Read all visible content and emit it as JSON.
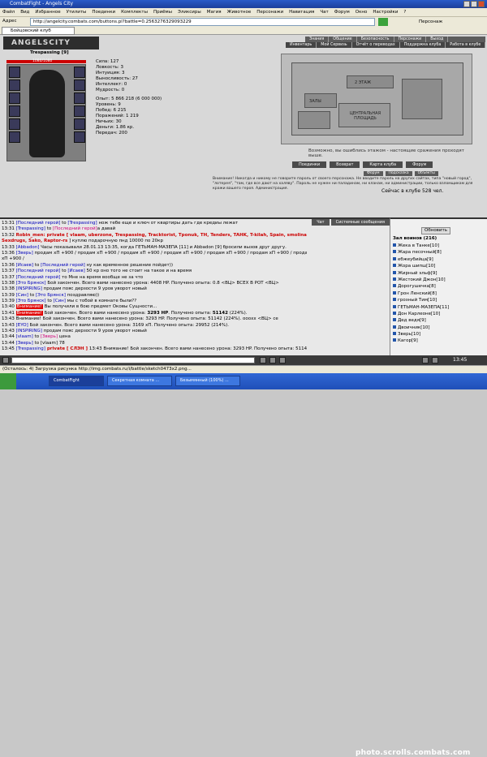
{
  "window": {
    "title": "CombatFight - Angels City"
  },
  "menu": [
    "Файл",
    "Вид",
    "Избранное",
    "Утилиты",
    "Поединки",
    "Комплекты",
    "Приёмы",
    "Эликсиры",
    "Магия",
    "Животное",
    "Персонажи",
    "Навигация",
    "Чат",
    "Форум",
    "Окно",
    "Настройки",
    "?"
  ],
  "address": {
    "label": "Адрес",
    "url": "http://angelcity.combats.com/buttons.pl?battle=0.2563276329093229",
    "go": "Персонаж"
  },
  "tab": {
    "label": "Бойцовский клуб"
  },
  "logo": {
    "text": "ANGELSCITY"
  },
  "topnav1": [
    "Знания",
    "Общение",
    "Безопасность",
    "Персонажи",
    "Выход"
  ],
  "topnav2": [
    "Инвентарь",
    "Мой Сервизь",
    "Отчёт о переводах",
    "Поддержка клуба",
    "Работа в клубе"
  ],
  "character": {
    "name": "Trespassing",
    "level": "[9]",
    "hp_label": "1080/1080",
    "hp_fraction": 1.0,
    "stats": [
      "Сила: 127",
      "Ловкость: 3",
      "Интуиция: 3",
      "Выносливость: 27",
      "Интеллект: 0",
      "Мудрость: 0"
    ],
    "stats2": [
      "Опыт: 5 866 218 (6 000 000)",
      "Уровень: 9",
      "Побед: 6 215",
      "Поражений: 1 219",
      "Ничьих: 30",
      "Деньги: 1.86 кр.",
      "Передач: 200"
    ]
  },
  "map": {
    "labels": [
      "2 ЭТАЖ",
      "ЗАЛЫ",
      "ЦЕНТРАЛЬНАЯ ПЛОЩАДЬ"
    ],
    "caption": "Возможно, вы ошиблись этажом - настоящие сражения проходят выше."
  },
  "actions": [
    "Поединки",
    "Возврат",
    "Карта клуба",
    "Форум"
  ],
  "small_actions": [
    "Форум",
    "Подсказка",
    "Объекты"
  ],
  "warning": "Внимание! Никогда и никому не говорите пароль от своего персонажа. Не вводите пароль на других сайтах, типа \"новый город\", \"лотерея\", \"там, где все дают на халяву\". Пароль не нужен ни паладинам, ни кланам, ни администрации, только взломщикам для кражи вашего героя. Администрация.",
  "club_online": "Сейчас в клубе 528 чел.",
  "chat_tabs": [
    "Чат",
    "Системные сообщения"
  ],
  "chat": [
    {
      "t": "13:31",
      "parts": [
        [
          "nick",
          "[Последний герой]"
        ],
        [
          "txt",
          " to "
        ],
        [
          "nick",
          "[Trespassing]"
        ],
        [
          "txt",
          " нож тебе еще и ключ от квартиры дать где кредиы лежат"
        ]
      ]
    },
    {
      "t": "13:31",
      "parts": [
        [
          "nick",
          "[Trespassing]"
        ],
        [
          "txt",
          " to "
        ],
        [
          "pink",
          "[Последний герой]"
        ],
        [
          "txt",
          "а давай"
        ]
      ]
    },
    {
      "t": "13:32",
      "parts": [
        [
          "red",
          "Robin_men: private [ vlaam, uberzone, Trespassing, Tracktorist, Tponuk, TH, Tenders, TAHK, T-kilah, Spain, smolina, silver knife,"
        ]
      ]
    },
    {
      "t": "",
      "parts": [
        [
          "red",
          "Sexdrugs, Sako, Raptor-rs"
        ],
        [
          "txt",
          " ] куплю подарочную пнд 10000 по 20кр"
        ]
      ]
    },
    {
      "t": "13:33",
      "parts": [
        [
          "nick",
          "[Abbadon]"
        ],
        [
          "txt",
          " Часы показывали 28.01.13 13:35, когда ГЕТЬМАН-МАЗЕПА [11] и Abbadon [9] бросили вызов друг другу."
        ]
      ]
    },
    {
      "t": "13:36",
      "parts": [
        [
          "nick",
          "[Зверь]"
        ],
        [
          "txt",
          " продам хП +900 / продам хП +900 / продам хП +900 / продам хП +900 / продам хП +900 / продам хП +900 / продам хП +900 / продам"
        ]
      ]
    },
    {
      "t": "",
      "parts": [
        [
          "txt",
          "хП +900 /"
        ]
      ]
    },
    {
      "t": "13:36",
      "parts": [
        [
          "nick",
          "[Исаев]"
        ],
        [
          "txt",
          " to "
        ],
        [
          "nick",
          "[Последний герой]"
        ],
        [
          "txt",
          " ну как временное решение пойдет))"
        ]
      ]
    },
    {
      "t": "13:37",
      "parts": [
        [
          "nick",
          "[Последний герой]"
        ],
        [
          "txt",
          " to "
        ],
        [
          "nick",
          "[Исаев]"
        ],
        [
          "txt",
          " 50 кр оно того не стоит на такое и на время"
        ]
      ]
    },
    {
      "t": "13:37",
      "parts": [
        [
          "nick",
          "[Последний герой]"
        ],
        [
          "txt",
          " то Мне на время вообще не за что"
        ]
      ]
    },
    {
      "t": "13:38",
      "parts": [
        [
          "nick",
          "[Это Брянск]"
        ],
        [
          "txt",
          " Бой закончен. Всего вами нанесено урона: 4408 HP. Получено опыта: 0.8 <ВЦ> ВСЕХ В РОТ <ВЦ>"
        ]
      ]
    },
    {
      "t": "13:38",
      "parts": [
        [
          "nick",
          "[INSPIRING]"
        ],
        [
          "txt",
          " продам пояс дерзости 9 уров уворот новый"
        ]
      ]
    },
    {
      "t": "13:39",
      "parts": [
        [
          "nick",
          "[Син]"
        ],
        [
          "txt",
          " to "
        ],
        [
          "nick",
          "[Это Брянск]"
        ],
        [
          "txt",
          " поздравляю))"
        ]
      ]
    },
    {
      "t": "13:39",
      "parts": [
        [
          "nick",
          "[Это Брянск]"
        ],
        [
          "txt",
          " to "
        ],
        [
          "nick",
          "[Син]"
        ],
        [
          "txt",
          " мы с тобой в комнате были??"
        ]
      ]
    },
    {
      "t": "13:40",
      "parts": [
        [
          "hl",
          "Внимание!"
        ],
        [
          "txt",
          " Вы получили в бою предмет Оковы Сущности..."
        ]
      ]
    },
    {
      "t": "13:41",
      "parts": [
        [
          "hl",
          "Внимание!"
        ],
        [
          "txt",
          " Бой закончен. Всего вами нанесено урона: "
        ],
        [
          "dmg",
          "3293 HP"
        ],
        [
          "txt",
          ". Получено опыта: "
        ],
        [
          "dmg",
          "51142"
        ],
        [
          "txt",
          " (224%)."
        ]
      ]
    },
    {
      "t": "13:43",
      "parts": [
        [
          "txt",
          "Внимание! Бой закончен. Всего вами нанесено урона: 3293 HP. Получено опыта: 51142 (224%). ооохх <ВЦ> се"
        ]
      ]
    },
    {
      "t": "13:43",
      "parts": [
        [
          "nick",
          "[EYO]"
        ],
        [
          "txt",
          " Бой закончен. Всего вами нанесено урона: 3169 хП. Получено опыта: 29952 (214%)."
        ]
      ]
    },
    {
      "t": "13:43",
      "parts": [
        [
          "nick",
          "[INSPIRING]"
        ],
        [
          "txt",
          " продам пояс дерзости 9 уров уворот новый"
        ]
      ]
    },
    {
      "t": "13:44",
      "parts": [
        [
          "nick",
          "[vlaam]"
        ],
        [
          "txt",
          " to "
        ],
        [
          "pink",
          "[Зверь]"
        ],
        [
          "txt",
          " цена"
        ]
      ]
    },
    {
      "t": "13:44",
      "parts": [
        [
          "nick",
          "[Зверь]"
        ],
        [
          "txt",
          " to [vlaam] 78"
        ]
      ]
    },
    {
      "t": "13:45",
      "parts": [
        [
          "nick",
          "[Trespassing]"
        ],
        [
          "red",
          " private [ СЛЭН ]"
        ],
        [
          "txt",
          " 13:43 Внимание! Бой закончен. Всего вами нанесено урона: 3293 HP. Получено опыта: 51142 (224%)."
        ]
      ]
    }
  ],
  "roster": {
    "refresh": "Обновить",
    "header": "Зал воинов (216)",
    "items": [
      "Жека в Танке[10]",
      "Жара песочный[8]",
      "ебжеубийца[9]",
      "Жора шипш[10]",
      "Жирный эльф[9]",
      "Жестокий Джон[10]",
      "Дорогушечка[8]",
      "Грон Ленский[8]",
      "грозный Тим[10]",
      "ГЕТЬМАН-МАЗЕПА[11]",
      "Дон Карлеоне[10]",
      "Дед ведя[9]",
      "Двоичник[10]",
      "Зверь[10]",
      "Кагор[9]"
    ]
  },
  "clock": "13:45",
  "status": "(Осталось: 4) Загрузка рисунка http://img.combats.ru/i/battle/sketch0473x2.png...",
  "tasks": [
    "CombatFight",
    "Секретная комната ...",
    "Безымянный (100%) ..."
  ],
  "watermark": "photo.scrolls.combats.com"
}
